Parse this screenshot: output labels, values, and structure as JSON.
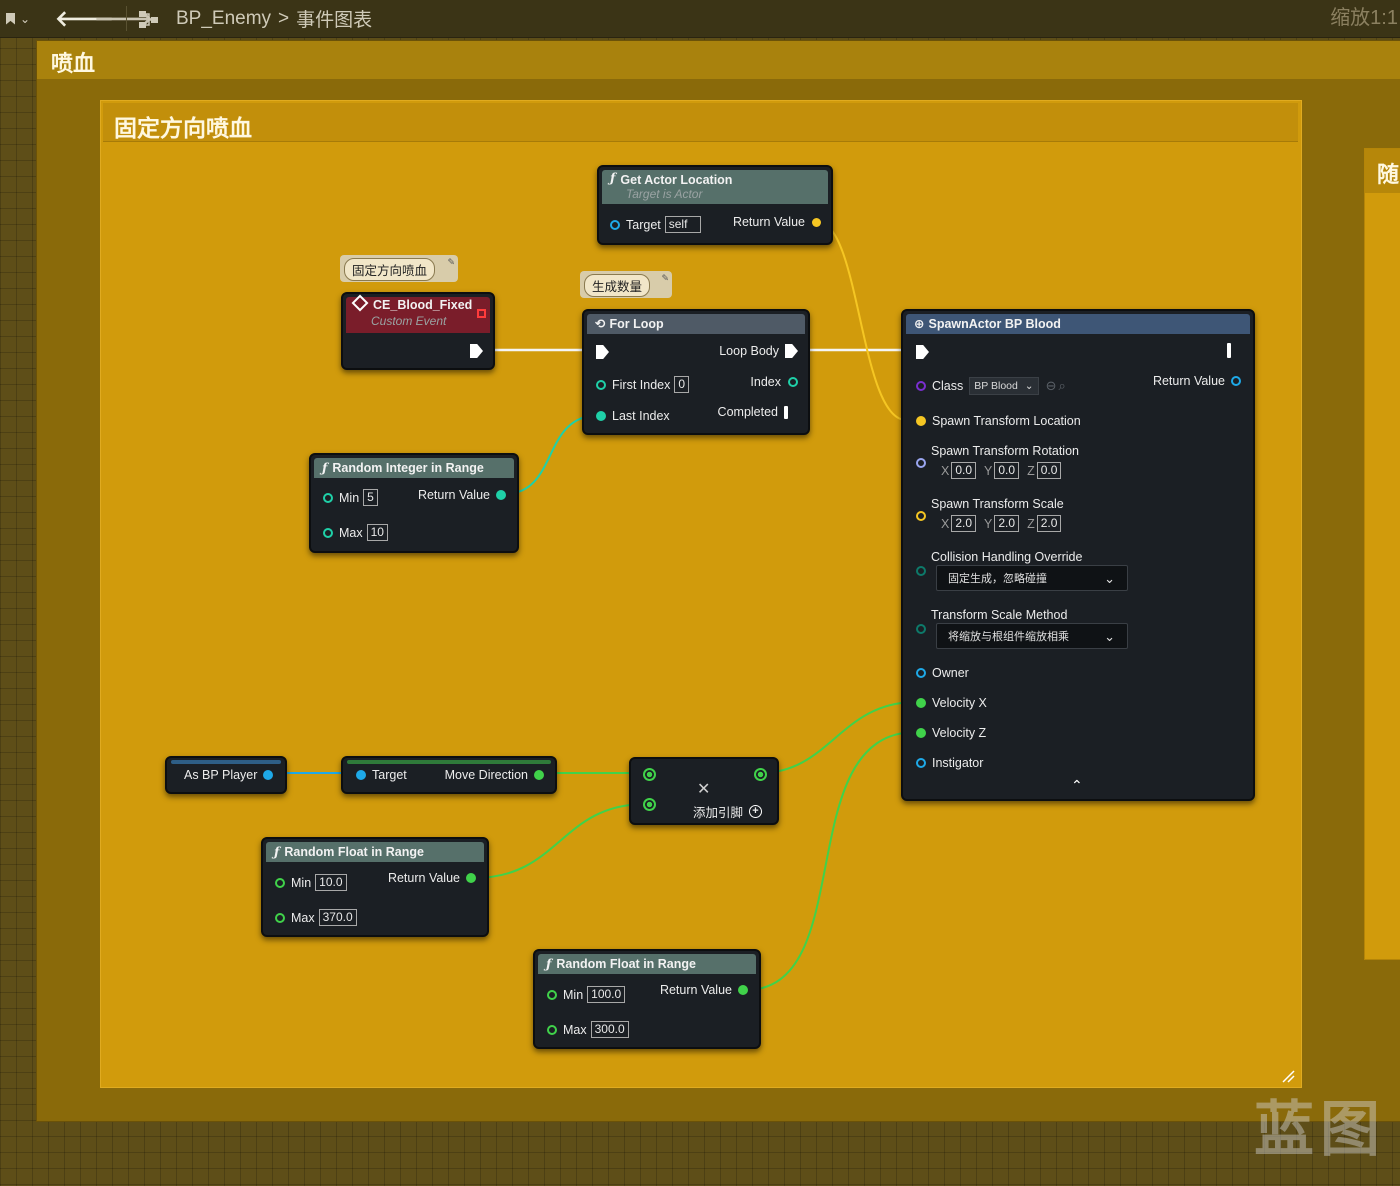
{
  "toolbar": {
    "breadcrumb_blueprint": "BP_Enemy",
    "breadcrumb_separator": ">",
    "breadcrumb_graph": "事件图表",
    "zoom": "缩放1:1"
  },
  "comments": {
    "outer_title": "喷血",
    "inner_title": "固定方向喷血",
    "right_title": "随"
  },
  "bubbles": {
    "event_comment": "固定方向喷血",
    "loop_comment": "生成数量"
  },
  "nodes": {
    "get_actor_location": {
      "title": "Get Actor Location",
      "subtitle": "Target is Actor",
      "target_label": "Target",
      "target_value": "self",
      "return_label": "Return Value"
    },
    "custom_event": {
      "title": "CE_Blood_Fixed",
      "subtitle": "Custom Event"
    },
    "for_loop": {
      "title": "For Loop",
      "loop_body": "Loop Body",
      "first_index_label": "First Index",
      "first_index_value": "0",
      "index_label": "Index",
      "last_index_label": "Last Index",
      "completed_label": "Completed"
    },
    "random_int": {
      "title": "Random Integer in Range",
      "min_label": "Min",
      "min_value": "5",
      "max_label": "Max",
      "max_value": "10",
      "return_label": "Return Value"
    },
    "spawn_actor": {
      "title": "SpawnActor BP Blood",
      "class_label": "Class",
      "class_value": "BP Blood",
      "return_label": "Return Value",
      "spawn_location": "Spawn Transform Location",
      "spawn_rotation": "Spawn Transform Rotation",
      "rotation": {
        "x": "0.0",
        "y": "0.0",
        "z": "0.0"
      },
      "spawn_scale": "Spawn Transform Scale",
      "scale": {
        "x": "2.0",
        "y": "2.0",
        "z": "2.0"
      },
      "axis_x": "X",
      "axis_y": "Y",
      "axis_z": "Z",
      "collision_label": "Collision Handling Override",
      "collision_value": "固定生成，忽略碰撞",
      "scale_method_label": "Transform Scale Method",
      "scale_method_value": "将缩放与根组件缩放相乘",
      "owner": "Owner",
      "velocity_x": "Velocity X",
      "velocity_z": "Velocity Z",
      "instigator": "Instigator"
    },
    "as_bp_player": {
      "label": "As BP Player"
    },
    "move_direction": {
      "target_label": "Target",
      "return_label": "Move Direction"
    },
    "make_array": {
      "add_pin_label": "添加引脚"
    },
    "random_float_1": {
      "title": "Random Float in Range",
      "min_label": "Min",
      "min_value": "10.0",
      "max_label": "Max",
      "max_value": "370.0",
      "return_label": "Return Value"
    },
    "random_float_2": {
      "title": "Random Float in Range",
      "min_label": "Min",
      "min_value": "100.0",
      "max_label": "Max",
      "max_value": "300.0",
      "return_label": "Return Value"
    }
  },
  "watermark": "蓝图",
  "colors": {
    "comment_outer": "#8c6a08",
    "comment_inner": "#d19b0c",
    "vector_pin": "#f5c623",
    "float_pin": "#40d24a",
    "int_pin": "#1fd0a8",
    "object_pin": "#1ea9e8",
    "class_pin": "#7a2fd0",
    "rotator_pin": "#9aa6f0",
    "function_header": "#56706a",
    "event_header": "#7a1d2a",
    "macro_header": "#4f5a66",
    "spawn_header": "#3e5676"
  }
}
